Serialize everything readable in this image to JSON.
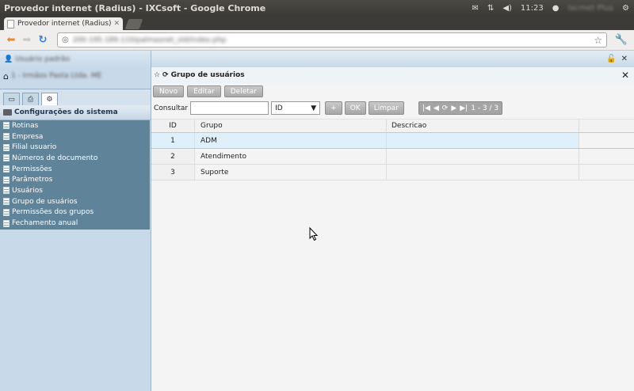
{
  "window": {
    "title": "Provedor internet (Radius) - IXCsoft - Google Chrome",
    "clock": "11:23",
    "user": "Ixcmet Plus"
  },
  "browser": {
    "tab_label": "Provedor internet (Radius)",
    "url": "200.195.189.110/palmasnet_old/index.php"
  },
  "left_panel": {
    "user_name": "Usuário padrão",
    "company": "1 - Irmãos Pasta Ltda. ME",
    "menu_header": "Configurações do sistema",
    "menu_items": [
      "Rotinas",
      "Empresa",
      "Filial usuario",
      "Números de documento",
      "Permissões",
      "Parâmetros",
      "Usuários",
      "Grupo de usuários",
      "Permissões dos grupos",
      "Fechamento anual"
    ]
  },
  "main": {
    "title": "Grupo de usuários",
    "buttons": {
      "new": "Novo",
      "edit": "Editar",
      "delete": "Deletar"
    },
    "search": {
      "label": "Consultar",
      "value": "",
      "field": "ID",
      "add": "+",
      "ok": "OK",
      "clear": "Limpar"
    },
    "pager": {
      "range": "1 - 3 / 3"
    },
    "grid": {
      "headers": {
        "id": "ID",
        "group": "Grupo",
        "description": "Descricao"
      },
      "rows": [
        {
          "id": "1",
          "group": "ADM",
          "description": ""
        },
        {
          "id": "2",
          "group": "Atendimento",
          "description": ""
        },
        {
          "id": "3",
          "group": "Suporte",
          "description": ""
        }
      ]
    }
  }
}
